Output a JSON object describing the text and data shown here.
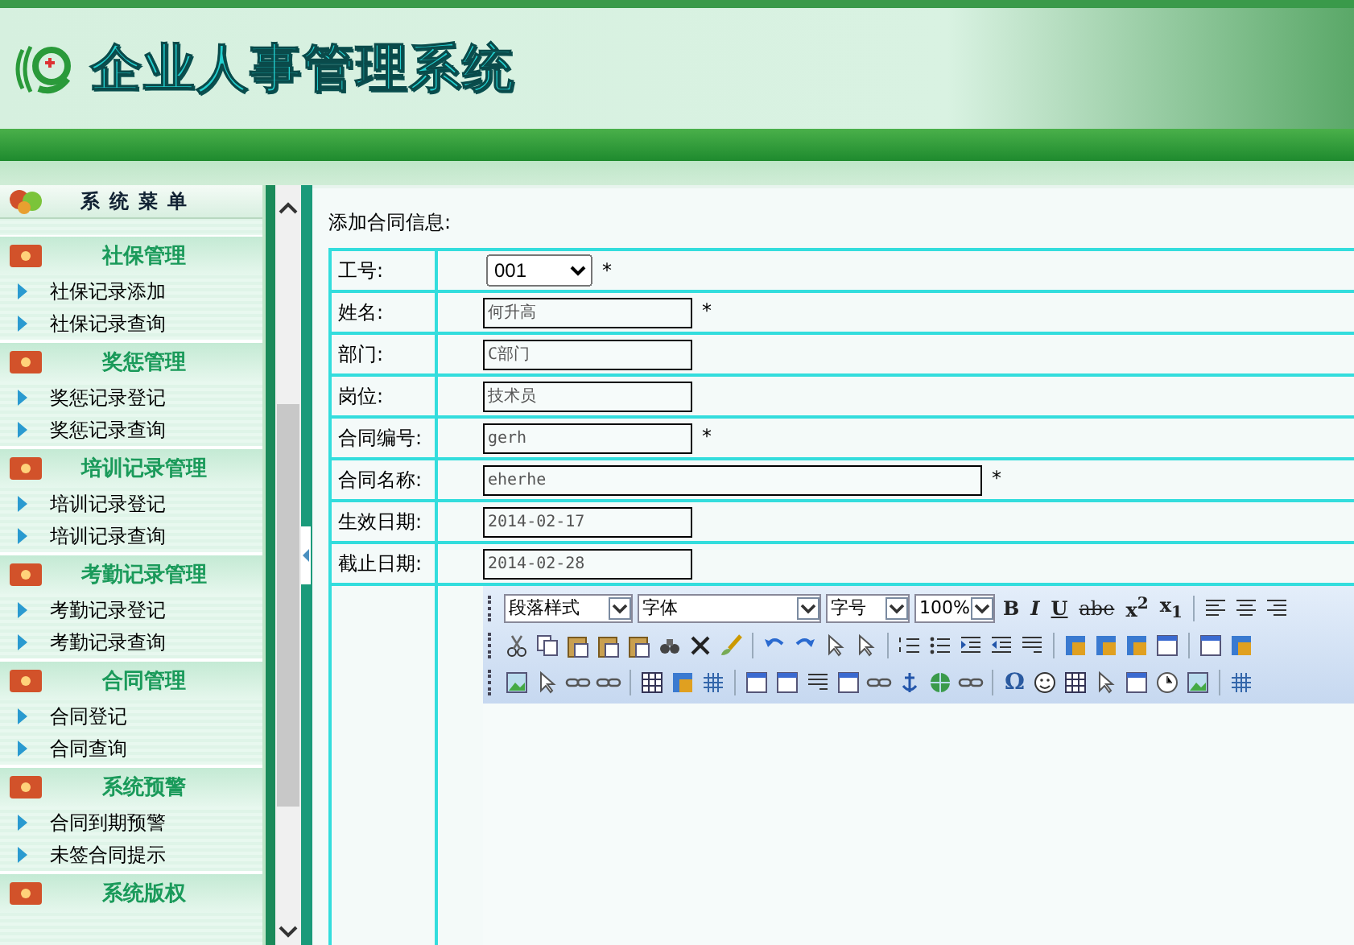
{
  "header": {
    "title": "企业人事管理系统"
  },
  "sidebar": {
    "title": "系统菜单",
    "groups": [
      {
        "title": "社保管理",
        "items": [
          "社保记录添加",
          "社保记录查询"
        ]
      },
      {
        "title": "奖惩管理",
        "items": [
          "奖惩记录登记",
          "奖惩记录查询"
        ]
      },
      {
        "title": "培训记录管理",
        "items": [
          "培训记录登记",
          "培训记录查询"
        ]
      },
      {
        "title": "考勤记录管理",
        "items": [
          "考勤记录登记",
          "考勤记录查询"
        ]
      },
      {
        "title": "合同管理",
        "items": [
          "合同登记",
          "合同查询"
        ]
      },
      {
        "title": "系统预警",
        "items": [
          "合同到期预警",
          "未签合同提示"
        ]
      },
      {
        "title": "系统版权"
      }
    ]
  },
  "form": {
    "heading": "添加合同信息:",
    "rows": [
      {
        "kind": "select",
        "label": "工号:",
        "value": "001",
        "mark": "*"
      },
      {
        "kind": "text",
        "label": "姓名:",
        "value": "何升高",
        "mark": "*"
      },
      {
        "kind": "text",
        "label": "部门:",
        "value": "C部门"
      },
      {
        "kind": "text",
        "label": "岗位:",
        "value": "技术员"
      },
      {
        "kind": "text",
        "label": "合同编号:",
        "value": "gerh",
        "mark": "*"
      },
      {
        "kind": "text",
        "label": "合同名称:",
        "value": "eherhe",
        "mark": "*",
        "wide": true
      },
      {
        "kind": "text",
        "label": "生效日期:",
        "value": "2014-02-17"
      },
      {
        "kind": "text",
        "label": "截止日期:",
        "value": "2014-02-28"
      },
      {
        "kind": "editor"
      }
    ]
  },
  "editor": {
    "selects": [
      {
        "value": "段落样式"
      },
      {
        "value": "字体",
        "wide": true
      },
      {
        "value": "字号"
      },
      {
        "value": "100%"
      }
    ],
    "format_buttons": [
      "B",
      "I",
      "U",
      "abe",
      "x$^{2}$",
      "x$_{1}$"
    ],
    "symbol_button": "Ω"
  }
}
